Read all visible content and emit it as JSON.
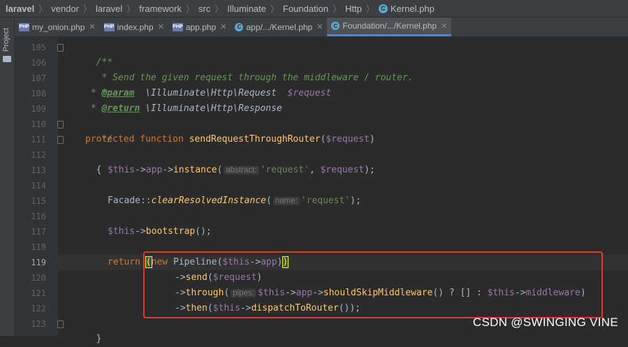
{
  "breadcrumb": [
    "laravel",
    "vendor",
    "laravel",
    "framework",
    "src",
    "Illuminate",
    "Foundation",
    "Http",
    "Kernel.php"
  ],
  "sidebar": {
    "project_label": "Project"
  },
  "tabs": [
    {
      "label": "my_onion.php",
      "icon": "php-icon"
    },
    {
      "label": "index.php",
      "icon": "php-icon"
    },
    {
      "label": "app.php",
      "icon": "php-icon"
    },
    {
      "label": "app/.../Kernel.php",
      "icon": "class-icon"
    },
    {
      "label": "Foundation/.../Kernel.php",
      "icon": "class-icon",
      "active": true
    }
  ],
  "code": {
    "line_numbers": [
      "105",
      "106",
      "107",
      "108",
      "109",
      "110",
      "111",
      "112",
      "113",
      "114",
      "115",
      "116",
      "117",
      "118",
      "119",
      "120",
      "121",
      "122",
      "123"
    ],
    "current_line": "119",
    "l105": "/**",
    "l106": " * Send the given request through the middleware / router.",
    "l107": " *",
    "l108_star": " * ",
    "l108_tag": "@param",
    "l108_type": "  \\Illuminate\\Http\\Request  ",
    "l108_var": "$request",
    "l109_star": " * ",
    "l109_tag": "@return",
    "l109_type": " \\Illuminate\\Http\\Response",
    "l110": " */",
    "l111_kw": "protected function ",
    "l111_fn": "sendRequestThroughRouter",
    "l111_p1": "(",
    "l111_var": "$request",
    "l111_p2": ")",
    "l112": "{",
    "l113_this": "$this",
    "l113_arrow": "->",
    "l113_app": "app",
    "l113_arrow2": "->",
    "l113_fn": "instance",
    "l113_p1": "(",
    "l113_hint": "abstract:",
    "l113_str": "'request'",
    "l113_comma": ", ",
    "l113_var": "$request",
    "l113_end": ");",
    "l115_cls": "Facade",
    "l115_dc": "::",
    "l115_fn": "clearResolvedInstance",
    "l115_p1": "(",
    "l115_hint": "name:",
    "l115_str": "'request'",
    "l115_end": ");",
    "l117_this": "$this",
    "l117_arrow": "->",
    "l117_fn": "bootstrap",
    "l117_end": "();",
    "l119_kw": "return ",
    "l119_p1": "(",
    "l119_new": "new ",
    "l119_cls": "Pipeline",
    "l119_p2": "(",
    "l119_this": "$this",
    "l119_arrow": "->",
    "l119_app": "app",
    "l119_p3": ")",
    "l119_p4": ")",
    "l120_arrow": "->",
    "l120_fn": "send",
    "l120_p1": "(",
    "l120_var": "$request",
    "l120_p2": ")",
    "l121_arrow": "->",
    "l121_fn": "through",
    "l121_p1": "(",
    "l121_hint": "pipes:",
    "l121_this": "$this",
    "l121_arrow2": "->",
    "l121_app": "app",
    "l121_arrow3": "->",
    "l121_fn2": "shouldSkipMiddleware",
    "l121_mid": "() ? [] : ",
    "l121_this2": "$this",
    "l121_arrow4": "->",
    "l121_mw": "middleware",
    "l121_p2": ")",
    "l122_arrow": "->",
    "l122_fn": "then",
    "l122_p1": "(",
    "l122_this": "$this",
    "l122_arrow2": "->",
    "l122_fn2": "dispatchToRouter",
    "l122_end": "());",
    "l123": "}"
  },
  "watermark": "CSDN @SWINGING   VINE"
}
